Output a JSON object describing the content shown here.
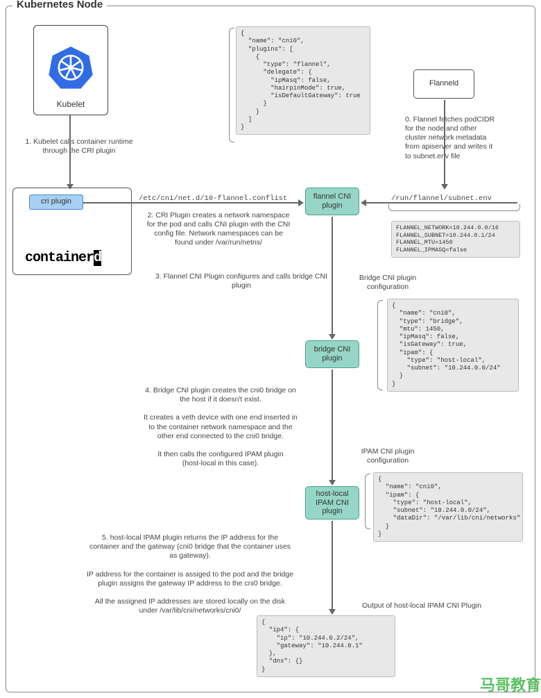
{
  "title": "Kubernetes Node",
  "kubelet": "Kubelet",
  "cri_plugin": "cri plugin",
  "containerd": "container",
  "containerd_suffix": "d",
  "flanneld": "Flanneld",
  "boxes": {
    "flannel": "flannel CNI\nplugin",
    "bridge": "bridge CNI\nplugin",
    "ipam": "host-local\nIPAM CNI\nplugin"
  },
  "labels": {
    "step1": "1. Kubelet calls container\nruntime through the CRI plugin",
    "cni_path": "/etc/cni/net.d/10-flannel.conflist",
    "step2": "2. CRI Plugin creates a network\nnamespace for the pod and calls\nCNI plugin with the CNI config file.\nNetwork namespaces can be found\nunder /var/run/netns/",
    "step3": "3. Flannel CNI Plugin configures and calls\nbridge CNI plugin",
    "bridge_conf": "Bridge CNI plugin\nconfiguration",
    "step4": "4. Bridge CNI plugin creates the cni0 bridge on\nthe host  if it doesn't exist.\n\nIt creates a veth device with one end inserted in\nto the container network namespace and the\nother end connected to the cni0 bridge.\n\nIt then calls the configured IPAM plugin\n(host-local in this case).",
    "ipam_conf": "IPAM CNI plugin\nconfiguration",
    "step5": "5. host-local IPAM plugin returns the IP address for the\ncontainer and the gateway (cni0 bridge that the container uses\nas gateway).\n\nIP address for the container is assiged to the pod and the bridge\nplugin assigns the gateway IP address to the cni0 bridge.\n\nAll the assigned IP addresses are stored locally on the disk\nunder /var/lib/cni/networks/cni0/",
    "step0": "0. Flannel fetches\npodCIDR for the node\nand other cluster\nnetwork metadata from\napiserver and writes it\nto subnet.env file",
    "subnet_path": "/run/flannel/subnet.env",
    "output_label": "Output of host-local IPAM CNI Plugin"
  },
  "code": {
    "cni_conf": "{\n  \"name\": \"cni0\",\n  \"plugins\": [\n    {\n      \"type\": \"flannel\",\n      \"delegate\": {\n        \"ipMasq\": false,\n        \"hairpinMode\": true,\n        \"isDefaultGateway\": true\n      }\n    }\n  ]\n}",
    "subnet_env": "FLANNEL_NETWORK=10.244.0.0/16\nFLANNEL_SUBNET=10.244.0.1/24\nFLANNEL_MTU=1450\nFLANNEL_IPMASQ=false",
    "bridge_conf": "{\n  \"name\": \"cni0\",\n  \"type\": \"bridge\",\n  \"mtu\": 1450,\n  \"ipMasq\": false,\n  \"isGateway\": true,\n  \"ipam\": {\n    \"type\": \"host-local\",\n    \"subnet\": \"10.244.0.0/24\"\n  }\n}",
    "ipam_conf": "{\n  \"name\": \"cni0\",\n  \"ipam\": {\n    \"type\": \"host-local\",\n    \"subnet\": \"10.244.0.0/24\",\n    \"dataDir\": \"/var/lib/cni/networks\"\n  }\n}",
    "output": "{\n  \"ip4\": {\n    \"ip\": \"10.244.0.2/24\",\n    \"gateway\": \"10.244.0.1\"\n  },\n  \"dns\": {}\n}"
  },
  "watermark": "马哥教育"
}
